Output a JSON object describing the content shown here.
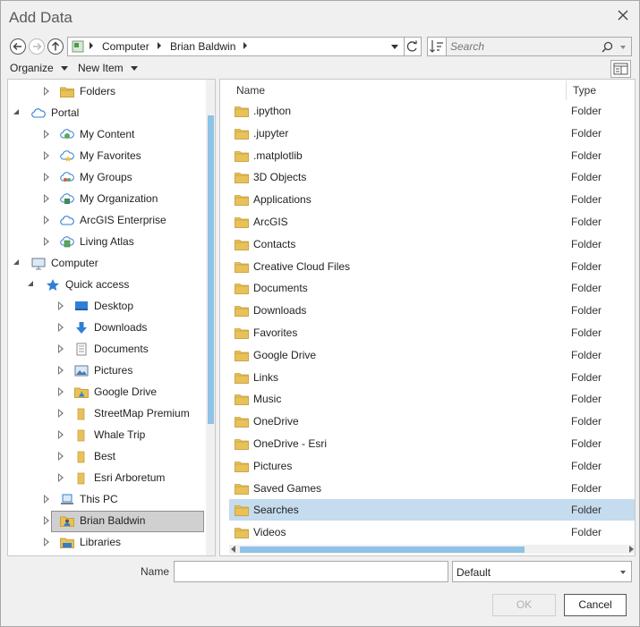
{
  "window": {
    "title": "Add Data"
  },
  "address": {
    "crumbs": [
      "Computer",
      "Brian Baldwin"
    ]
  },
  "search": {
    "placeholder": "Search"
  },
  "toolbar": {
    "organize_label": "Organize",
    "new_item_label": "New Item"
  },
  "tree": {
    "items": [
      {
        "label": "Folders",
        "icon": "folders-icon",
        "level": 1,
        "expander": "closed"
      },
      {
        "label": "Portal",
        "icon": "cloud-icon",
        "level": 0,
        "expander": "open"
      },
      {
        "label": "My Content",
        "icon": "my-content-icon",
        "level": 1,
        "expander": "closed"
      },
      {
        "label": "My Favorites",
        "icon": "my-favorites-icon",
        "level": 1,
        "expander": "closed"
      },
      {
        "label": "My Groups",
        "icon": "my-groups-icon",
        "level": 1,
        "expander": "closed"
      },
      {
        "label": "My Organization",
        "icon": "my-organization-icon",
        "level": 1,
        "expander": "closed"
      },
      {
        "label": "ArcGIS Enterprise",
        "icon": "cloud-icon",
        "level": 1,
        "expander": "closed"
      },
      {
        "label": "Living Atlas",
        "icon": "living-atlas-icon",
        "level": 1,
        "expander": "closed"
      },
      {
        "label": "Computer",
        "icon": "computer-icon",
        "level": 0,
        "expander": "open"
      },
      {
        "label": "Quick access",
        "icon": "star-icon",
        "level": 1,
        "expander": "open"
      },
      {
        "label": "Desktop",
        "icon": "desktop-icon",
        "level": 2,
        "expander": "closed"
      },
      {
        "label": "Downloads",
        "icon": "download-arrow-icon",
        "level": 2,
        "expander": "closed"
      },
      {
        "label": "Documents",
        "icon": "document-icon",
        "level": 2,
        "expander": "closed"
      },
      {
        "label": "Pictures",
        "icon": "picture-icon",
        "level": 2,
        "expander": "closed"
      },
      {
        "label": "Google Drive",
        "icon": "google-drive-folder-icon",
        "level": 2,
        "expander": "closed"
      },
      {
        "label": "StreetMap Premium",
        "icon": "folder-icon",
        "level": 2,
        "expander": "closed"
      },
      {
        "label": "Whale Trip",
        "icon": "folder-icon",
        "level": 2,
        "expander": "closed"
      },
      {
        "label": "Best",
        "icon": "folder-icon",
        "level": 2,
        "expander": "closed"
      },
      {
        "label": "Esri Arboretum",
        "icon": "folder-icon",
        "level": 2,
        "expander": "closed"
      },
      {
        "label": "This PC",
        "icon": "laptop-icon",
        "level": 1,
        "expander": "closed"
      },
      {
        "label": "Brian Baldwin",
        "icon": "user-folder-icon",
        "level": 1,
        "expander": "closed",
        "selected": true
      },
      {
        "label": "Libraries",
        "icon": "libraries-icon",
        "level": 1,
        "expander": "closed"
      }
    ]
  },
  "list": {
    "columns": {
      "name": "Name",
      "type": "Type"
    },
    "rows": [
      {
        "name": ".ipython",
        "type": "Folder"
      },
      {
        "name": ".jupyter",
        "type": "Folder"
      },
      {
        "name": ".matplotlib",
        "type": "Folder"
      },
      {
        "name": "3D Objects",
        "type": "Folder"
      },
      {
        "name": "Applications",
        "type": "Folder"
      },
      {
        "name": "ArcGIS",
        "type": "Folder"
      },
      {
        "name": "Contacts",
        "type": "Folder"
      },
      {
        "name": "Creative Cloud Files",
        "type": "Folder"
      },
      {
        "name": "Documents",
        "type": "Folder"
      },
      {
        "name": "Downloads",
        "type": "Folder"
      },
      {
        "name": "Favorites",
        "type": "Folder"
      },
      {
        "name": "Google Drive",
        "type": "Folder"
      },
      {
        "name": "Links",
        "type": "Folder"
      },
      {
        "name": "Music",
        "type": "Folder"
      },
      {
        "name": "OneDrive",
        "type": "Folder"
      },
      {
        "name": "OneDrive - Esri",
        "type": "Folder"
      },
      {
        "name": "Pictures",
        "type": "Folder"
      },
      {
        "name": "Saved Games",
        "type": "Folder"
      },
      {
        "name": "Searches",
        "type": "Folder",
        "selected": true
      },
      {
        "name": "Videos",
        "type": "Folder"
      }
    ]
  },
  "footer": {
    "name_label": "Name",
    "name_value": "",
    "filter_value": "Default",
    "ok_label": "OK",
    "cancel_label": "Cancel"
  },
  "colors": {
    "selection": "#c5dbee",
    "tree_selection": "#d0d0d0",
    "folder": "#e8c15a",
    "scroll_thumb": "#8fc2e7",
    "accent": "#2f7fd6"
  }
}
